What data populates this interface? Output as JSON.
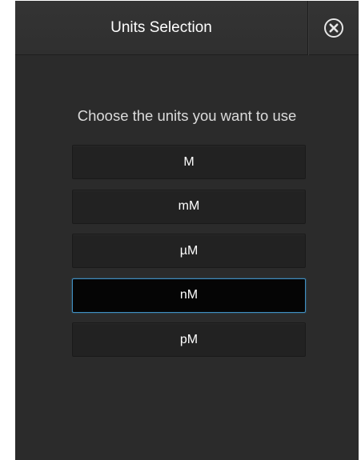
{
  "dialog": {
    "title": "Units Selection",
    "close_icon": "close-circle-x-icon",
    "instructions": "Choose the units you want to use"
  },
  "units": [
    {
      "label": "M",
      "selected": false
    },
    {
      "label": "mM",
      "selected": false
    },
    {
      "label": "µM",
      "selected": false
    },
    {
      "label": "nM",
      "selected": true
    },
    {
      "label": "pM",
      "selected": false
    }
  ],
  "colors": {
    "background": "#2b2b2b",
    "option_background": "#222222",
    "selected_background": "#050505",
    "selected_border": "#3f8fc2",
    "text": "#ffffff"
  }
}
